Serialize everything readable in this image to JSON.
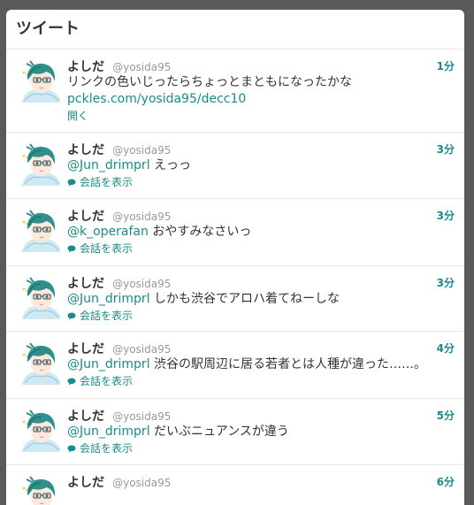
{
  "header": {
    "title": "ツイート"
  },
  "colors": {
    "accent": "#1a8a8a",
    "name": "#333333",
    "muted": "#999999"
  },
  "tweets": [
    {
      "name": "よしだ",
      "screen_name": "@yosida95",
      "time": "1分",
      "mention": "",
      "text": "リンクの色いじったらちょっとまともになったかな",
      "link": "pckles.com/yosida95/decc10",
      "action": "開く"
    },
    {
      "name": "よしだ",
      "screen_name": "@yosida95",
      "time": "3分",
      "mention": "@Jun_drimprl",
      "text": " えっっ",
      "link": "",
      "action": "会話を表示"
    },
    {
      "name": "よしだ",
      "screen_name": "@yosida95",
      "time": "3分",
      "mention": "@k_operafan",
      "text": " おやすみなさいっ",
      "link": "",
      "action": "会話を表示"
    },
    {
      "name": "よしだ",
      "screen_name": "@yosida95",
      "time": "3分",
      "mention": "@Jun_drimprl",
      "text": " しかも渋谷でアロハ着てねーしな",
      "link": "",
      "action": "会話を表示"
    },
    {
      "name": "よしだ",
      "screen_name": "@yosida95",
      "time": "4分",
      "mention": "@Jun_drimprl",
      "text": " 渋谷の駅周辺に居る若者とは人種が違った……。",
      "link": "",
      "action": "会話を表示"
    },
    {
      "name": "よしだ",
      "screen_name": "@yosida95",
      "time": "5分",
      "mention": "@Jun_drimprl",
      "text": " だいぶニュアンスが違う",
      "link": "",
      "action": "会話を表示"
    },
    {
      "name": "よしだ",
      "screen_name": "@yosida95",
      "time": "6分",
      "mention": "",
      "text": "",
      "link": "",
      "action": ""
    }
  ]
}
